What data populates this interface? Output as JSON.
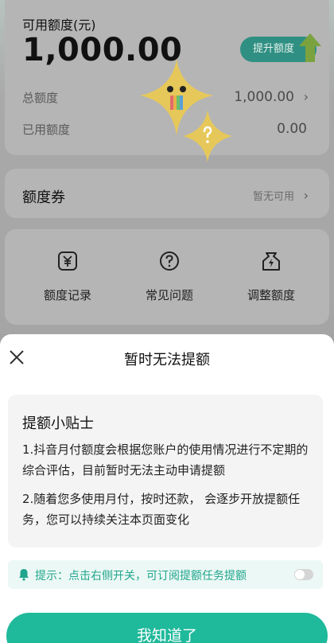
{
  "background": {
    "amount_card": {
      "available_label": "可用额度(元)",
      "available_amount": "1,000.00",
      "raise_button": "提升额度",
      "total_label": "总额度",
      "total_value": "1,000.00",
      "used_label": "已用额度",
      "used_value": "0.00"
    },
    "coupon_card": {
      "title": "额度券",
      "status": "暂无可用"
    },
    "actions": [
      {
        "label": "额度记录",
        "icon": "yuan-card-icon"
      },
      {
        "label": "常见问题",
        "icon": "question-circle-icon"
      },
      {
        "label": "调整额度",
        "icon": "lightning-bag-icon"
      }
    ],
    "chevron": "›"
  },
  "sheet": {
    "title": "暂时无法提额",
    "tips_title": "提额小贴士",
    "tips": [
      "1.抖音月付额度会根据您账户的使用情况进行不定期的综合评估，目前暂时无法主动申请提额",
      "2.随着您多使用月付，按时还款， 会逐步开放提额任务，您可以持续关注本页面变化"
    ],
    "notice": "提示：点击右侧开关，可订阅提额任务提额",
    "confirm_button": "我知道了"
  },
  "colors": {
    "accent": "#1fb99b",
    "notice_text": "#1ea58c",
    "overlay": "#a3a3a3"
  }
}
